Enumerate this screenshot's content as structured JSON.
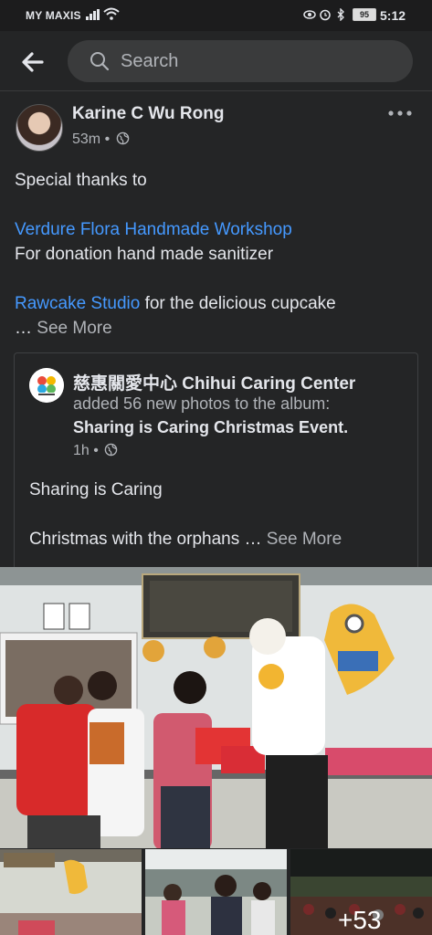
{
  "status_bar": {
    "carrier": "MY MAXIS",
    "battery": "95",
    "time": "5:12"
  },
  "search": {
    "placeholder": "Search"
  },
  "post": {
    "author": "Karine C Wu Rong",
    "time": "53m",
    "meta_separator": "•",
    "lines": {
      "thanks": "Special thanks to",
      "link1": "Verdure Flora Handmade Workshop",
      "donation": "For donation  hand made sanitizer",
      "link2": "Rawcake Studio",
      "cupcake_suffix": " for the delicious cupcake",
      "ellipsis": "… ",
      "see_more": "See More"
    }
  },
  "shared": {
    "page_name": "慈惠關愛中心 Chihui Caring Center",
    "album_action": "added 56 new photos to the album:",
    "album_name": "Sharing is Caring Christmas Event.",
    "time": "1h",
    "meta_separator": "•",
    "line1": "Sharing is Caring",
    "line2": "Christmas with the orphans … ",
    "see_more": "See More"
  },
  "photos": {
    "more_count": "+53"
  },
  "colors": {
    "background": "#242526",
    "link": "#4599ff",
    "secondary_text": "#b0b3b8"
  },
  "icons": [
    "signal-icon",
    "wifi-icon",
    "eye-icon",
    "alarm-icon",
    "bluetooth-icon",
    "battery-icon",
    "back-arrow-icon",
    "search-icon",
    "globe-icon",
    "more-options-icon",
    "page-logo"
  ]
}
